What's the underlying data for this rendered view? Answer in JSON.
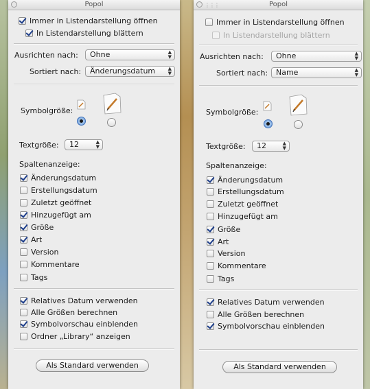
{
  "windows": [
    {
      "title": "Popol",
      "open_in_list": {
        "label": "Immer in Listendarstellung öffnen",
        "checked": true
      },
      "browse_in_list": {
        "label": "In Listendarstellung blättern",
        "checked": true,
        "enabled": true
      },
      "arrange_by": {
        "label": "Ausrichten nach:",
        "value": "Ohne"
      },
      "sort_by": {
        "label": "Sortiert nach:",
        "value": "Änderungsdatum"
      },
      "icon_size": {
        "label": "Symbolgröße:",
        "selected": "small"
      },
      "text_size": {
        "label": "Textgröße:",
        "value": "12"
      },
      "columns_label": "Spaltenanzeige:",
      "columns": [
        {
          "label": "Änderungsdatum",
          "checked": true
        },
        {
          "label": "Erstellungsdatum",
          "checked": false
        },
        {
          "label": "Zuletzt geöffnet",
          "checked": false
        },
        {
          "label": "Hinzugefügt am",
          "checked": true
        },
        {
          "label": "Größe",
          "checked": true
        },
        {
          "label": "Art",
          "checked": true
        },
        {
          "label": "Version",
          "checked": false
        },
        {
          "label": "Kommentare",
          "checked": false
        },
        {
          "label": "Tags",
          "checked": false
        }
      ],
      "options": [
        {
          "label": "Relatives Datum verwenden",
          "checked": true
        },
        {
          "label": "Alle Größen berechnen",
          "checked": false
        },
        {
          "label": "Symbolvorschau einblenden",
          "checked": true
        },
        {
          "label": "Ordner „Library“ anzeigen",
          "checked": false
        }
      ],
      "default_button": "Als Standard verwenden"
    },
    {
      "title": "Popol",
      "open_in_list": {
        "label": "Immer in Listendarstellung öffnen",
        "checked": false
      },
      "browse_in_list": {
        "label": "In Listendarstellung blättern",
        "checked": false,
        "enabled": false
      },
      "arrange_by": {
        "label": "Ausrichten nach:",
        "value": "Ohne"
      },
      "sort_by": {
        "label": "Sortiert nach:",
        "value": "Name"
      },
      "icon_size": {
        "label": "Symbolgröße:",
        "selected": "small"
      },
      "text_size": {
        "label": "Textgröße:",
        "value": "12"
      },
      "columns_label": "Spaltenanzeige:",
      "columns": [
        {
          "label": "Änderungsdatum",
          "checked": true
        },
        {
          "label": "Erstellungsdatum",
          "checked": false
        },
        {
          "label": "Zuletzt geöffnet",
          "checked": false
        },
        {
          "label": "Hinzugefügt am",
          "checked": false
        },
        {
          "label": "Größe",
          "checked": true
        },
        {
          "label": "Art",
          "checked": true
        },
        {
          "label": "Version",
          "checked": false
        },
        {
          "label": "Kommentare",
          "checked": false
        },
        {
          "label": "Tags",
          "checked": false
        }
      ],
      "options": [
        {
          "label": "Relatives Datum verwenden",
          "checked": true
        },
        {
          "label": "Alle Größen berechnen",
          "checked": false
        },
        {
          "label": "Symbolvorschau einblenden",
          "checked": true
        }
      ],
      "default_button": "Als Standard verwenden"
    }
  ],
  "colors": {
    "panel": "#ececec",
    "check": "#1c3d8a",
    "radio_selected": "#6a9bd8"
  },
  "icons": {
    "close": "close-icon",
    "grip": "grip-icon",
    "doc_small": "document-small-icon",
    "doc_large": "document-large-icon",
    "popup_arrows": "updown-arrows-icon"
  }
}
